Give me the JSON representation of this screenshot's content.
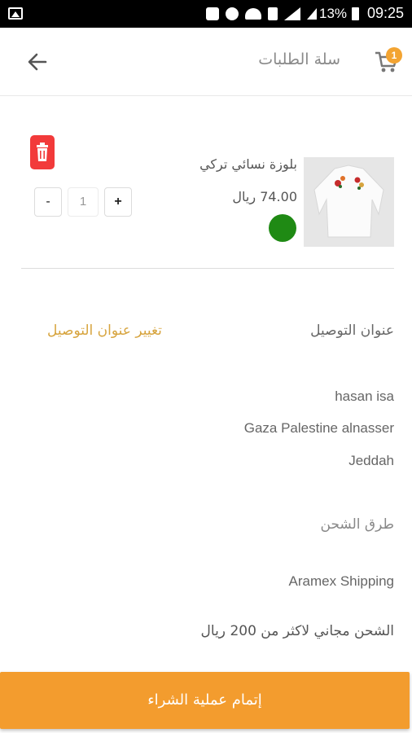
{
  "status_bar": {
    "battery_percent": "13%",
    "time": "09:25",
    "icons": [
      "gallery-icon",
      "mute-icon",
      "alarm-icon",
      "wifi-icon",
      "sim-icon",
      "signal-icon",
      "battery-icon"
    ]
  },
  "header": {
    "title": "سلة الطلبات",
    "cart_badge_count": "1",
    "back_icon": "arrow-left-icon",
    "cart_icon": "shopping-cart-icon"
  },
  "cart": {
    "items": [
      {
        "name": "بلوزة نسائي تركي",
        "price": "74.00 ريال",
        "color": "#1f8a14",
        "quantity": "1",
        "minus_label": "-",
        "plus_label": "+"
      }
    ]
  },
  "delivery": {
    "label": "عنوان التوصيل",
    "change_link": "تغيير عنوان التوصيل",
    "name": "hasan isa",
    "address_line": "Gaza Palestine alnasser",
    "city": "Jeddah"
  },
  "shipping": {
    "label": "طرق الشحن",
    "method": "Aramex Shipping",
    "note": "الشحن مجاني لاكثر من 200 ريال"
  },
  "checkout": {
    "label": "إتمام عملية الشراء"
  },
  "colors": {
    "accent": "#f39c2e",
    "badge": "#f3a432",
    "link": "#d7a43e",
    "delete": "#f23a3a"
  }
}
